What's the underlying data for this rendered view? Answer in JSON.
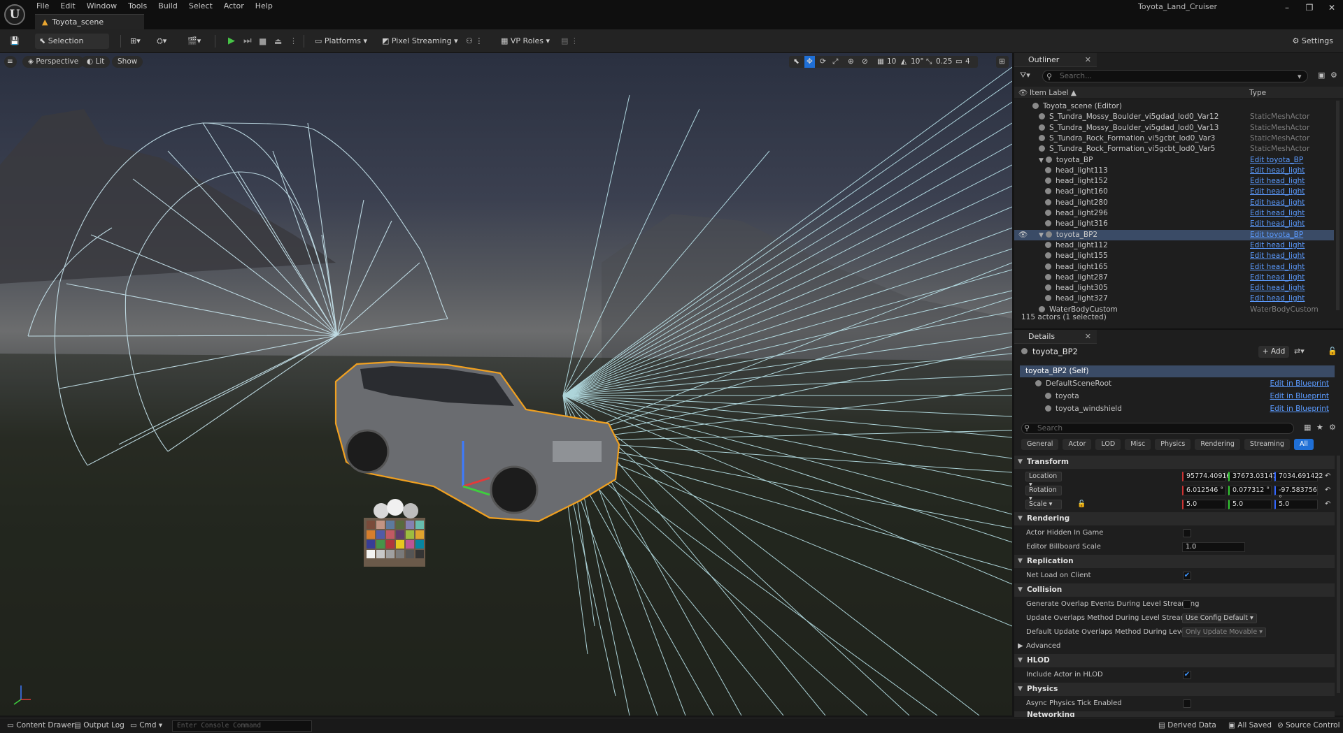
{
  "app": {
    "menu": [
      "File",
      "Edit",
      "Window",
      "Tools",
      "Build",
      "Select",
      "Actor",
      "Help"
    ],
    "document_tab": "Toyota_scene",
    "project_title": "Toyota_Land_Cruiser",
    "window_controls": [
      "–",
      "❐",
      "✕"
    ]
  },
  "toolbar": {
    "selection_mode": "Selection Mode",
    "platforms": "Platforms",
    "pixel_streaming": "Pixel Streaming",
    "vp_roles": "VP Roles",
    "settings": "Settings"
  },
  "viewport": {
    "perspective": "Perspective",
    "lit": "Lit",
    "show": "Show",
    "grid_snap": "10",
    "rot_snap": "10°",
    "scale_snap": "0.25",
    "camera_speed": "4"
  },
  "outliner": {
    "tab": "Outliner",
    "search_placeholder": "Search...",
    "col_label": "Item Label ▲",
    "col_type": "Type",
    "rows": [
      {
        "label": "Toyota_scene (Editor)",
        "type": "",
        "indent": 2
      },
      {
        "label": "S_Tundra_Mossy_Boulder_vi5gdad_lod0_Var12",
        "type": "StaticMeshActor",
        "indent": 3
      },
      {
        "label": "S_Tundra_Mossy_Boulder_vi5gdad_lod0_Var13",
        "type": "StaticMeshActor",
        "indent": 3
      },
      {
        "label": "S_Tundra_Rock_Formation_vi5gcbt_lod0_Var3",
        "type": "StaticMeshActor",
        "indent": 3
      },
      {
        "label": "S_Tundra_Rock_Formation_vi5gcbt_lod0_Var5",
        "type": "StaticMeshActor",
        "indent": 3
      },
      {
        "label": "toyota_BP",
        "type": "Edit toyota_BP",
        "indent": 3,
        "expand": true,
        "link": true
      },
      {
        "label": "head_light113",
        "type": "Edit head_light",
        "indent": 4,
        "link": true
      },
      {
        "label": "head_light152",
        "type": "Edit head_light",
        "indent": 4,
        "link": true
      },
      {
        "label": "head_light160",
        "type": "Edit head_light",
        "indent": 4,
        "link": true
      },
      {
        "label": "head_light280",
        "type": "Edit head_light",
        "indent": 4,
        "link": true
      },
      {
        "label": "head_light296",
        "type": "Edit head_light",
        "indent": 4,
        "link": true
      },
      {
        "label": "head_light316",
        "type": "Edit head_light",
        "indent": 4,
        "link": true
      },
      {
        "label": "toyota_BP2",
        "type": "Edit toyota_BP",
        "indent": 3,
        "expand": true,
        "link": true,
        "selected": true
      },
      {
        "label": "head_light112",
        "type": "Edit head_light",
        "indent": 4,
        "link": true
      },
      {
        "label": "head_light155",
        "type": "Edit head_light",
        "indent": 4,
        "link": true
      },
      {
        "label": "head_light165",
        "type": "Edit head_light",
        "indent": 4,
        "link": true
      },
      {
        "label": "head_light287",
        "type": "Edit head_light",
        "indent": 4,
        "link": true
      },
      {
        "label": "head_light305",
        "type": "Edit head_light",
        "indent": 4,
        "link": true
      },
      {
        "label": "head_light327",
        "type": "Edit head_light",
        "indent": 4,
        "link": true
      },
      {
        "label": "WaterBodyCustom",
        "type": "WaterBodyCustom",
        "indent": 3
      }
    ],
    "status": "115 actors (1 selected)"
  },
  "details": {
    "tab": "Details",
    "actor_name": "toyota_BP2",
    "add_label": "+ Add",
    "components": [
      {
        "label": "toyota_BP2 (Self)",
        "bp": "",
        "indent": 0,
        "selected": true
      },
      {
        "label": "DefaultSceneRoot",
        "bp": "Edit in Blueprint",
        "indent": 1
      },
      {
        "label": "toyota",
        "bp": "Edit in Blueprint",
        "indent": 2
      },
      {
        "label": "toyota_windshield",
        "bp": "Edit in Blueprint",
        "indent": 2
      }
    ],
    "search_placeholder": "Search",
    "filters": [
      "General",
      "Actor",
      "LOD",
      "Misc",
      "Physics",
      "Rendering",
      "Streaming",
      "All"
    ],
    "transform": {
      "section": "Transform",
      "location_label": "Location",
      "location": [
        "95774.409165",
        "37673.031476",
        "7034.691422"
      ],
      "rotation_label": "Rotation",
      "rotation": [
        "6.012546 °",
        "0.077312 °",
        "-97.583756 °"
      ],
      "scale_label": "Scale",
      "scale": [
        "5.0",
        "5.0",
        "5.0"
      ]
    },
    "rendering": {
      "section": "Rendering",
      "hidden_label": "Actor Hidden In Game",
      "billboard_label": "Editor Billboard Scale",
      "billboard": "1.0"
    },
    "replication": {
      "section": "Replication",
      "net_load_label": "Net Load on Client"
    },
    "collision": {
      "section": "Collision",
      "gen_overlap_label": "Generate Overlap Events During Level Streaming",
      "update_label": "Update Overlaps Method During Level Streaming",
      "update_value": "Use Config Default",
      "default_label": "Default Update Overlaps Method During Level Streaming",
      "default_value": "Only Update Movable"
    },
    "advanced": "Advanced",
    "hlod": {
      "section": "HLOD",
      "include_label": "Include Actor in HLOD"
    },
    "physics": {
      "section": "Physics",
      "async_label": "Async Physics Tick Enabled"
    },
    "networking": "Networking"
  },
  "statusbar": {
    "content_drawer": "Content Drawer",
    "output_log": "Output Log",
    "cmd": "Cmd",
    "console_placeholder": "Enter Console Command",
    "derived_data": "Derived Data",
    "all_saved": "All Saved",
    "source_control": "Source Control"
  },
  "colors": {
    "accent": "#1f6fd6",
    "selection": "#3a4b66",
    "link": "#5b9bff",
    "play": "#47c447",
    "selection_outline": "#f0a020",
    "light_rays": "#bfeff5"
  }
}
